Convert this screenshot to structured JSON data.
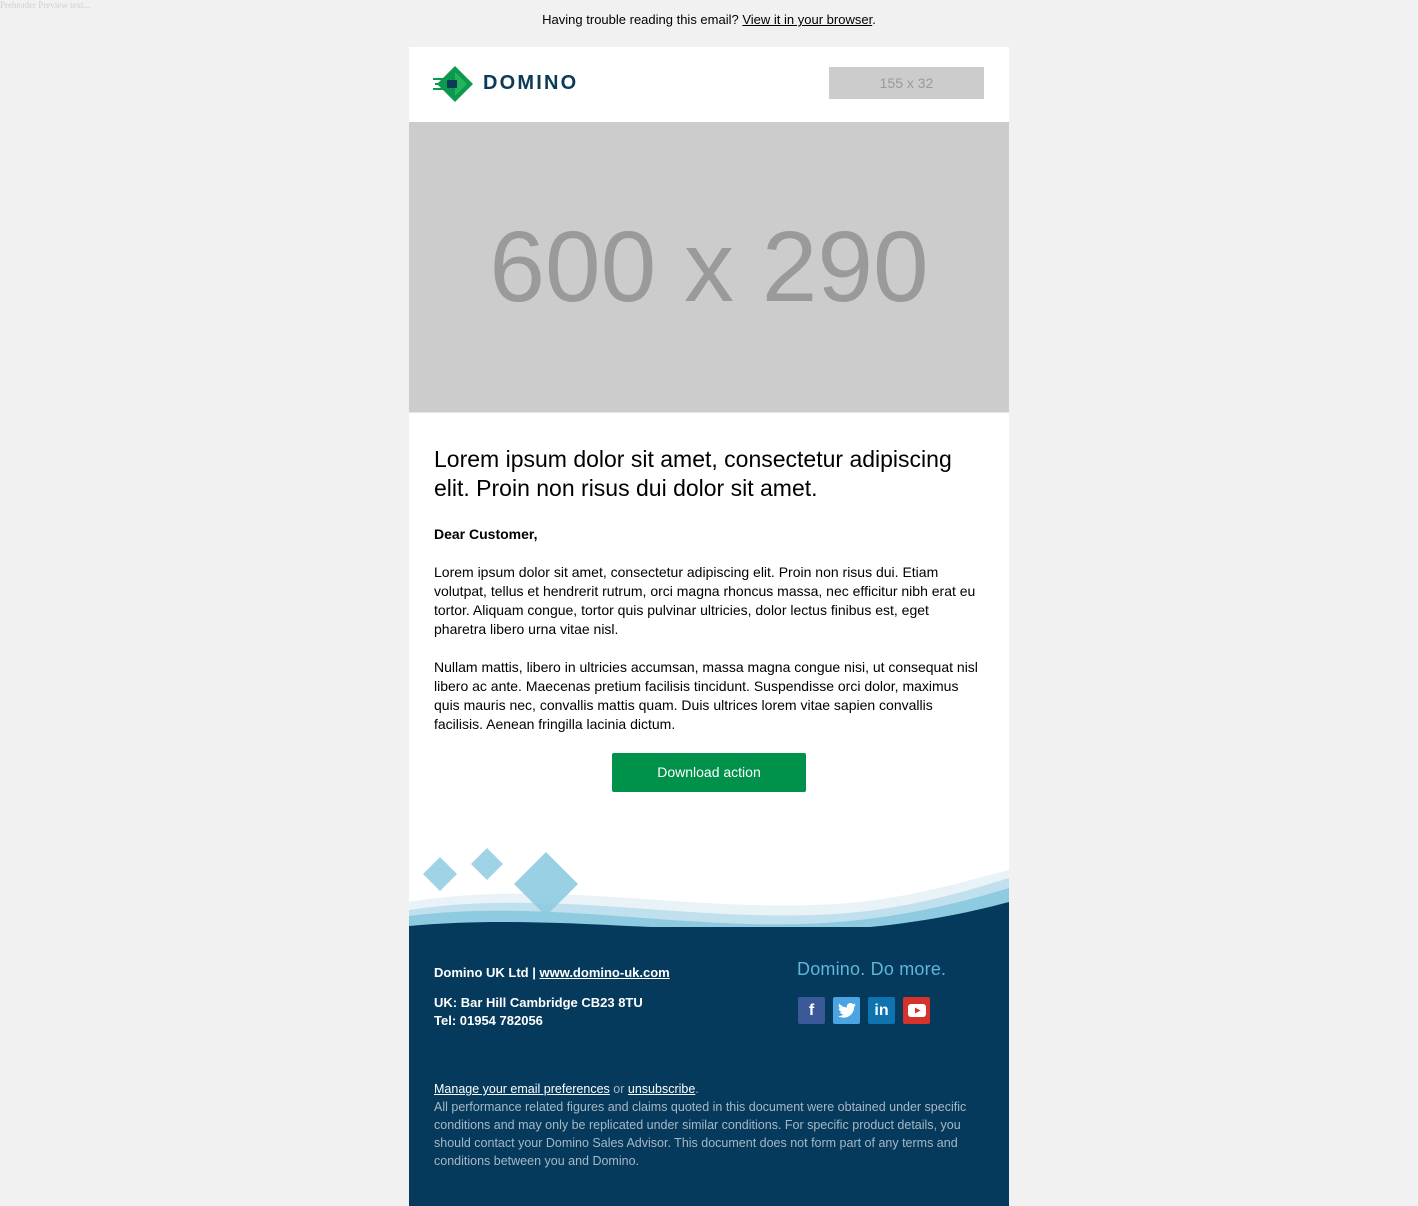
{
  "preheader": "Preheader Preview text...",
  "topbar": {
    "text": "Having trouble reading this email?",
    "link": "View it in your browser",
    "end": "."
  },
  "header": {
    "logo_text": "DOMINO",
    "placeholder": "155 x 32"
  },
  "hero": {
    "placeholder": "600 x 290"
  },
  "content": {
    "headline": "Lorem ipsum dolor sit amet, consectetur adipiscing elit. Proin non risus dui dolor sit amet.",
    "greeting": "Dear Customer,",
    "para1": "Lorem ipsum dolor sit amet, consectetur adipiscing elit. Proin non risus dui. Etiam volutpat, tellus et hendrerit rutrum, orci magna rhoncus massa, nec efficitur nibh erat eu tortor. Aliquam congue, tortor quis pulvinar ultricies, dolor lectus finibus est, eget pharetra libero urna vitae nisl.",
    "para2": "Nullam mattis, libero in ultricies accumsan, massa magna congue nisi, ut consequat nisl libero ac ante. Maecenas pretium facilisis tincidunt. Suspendisse orci dolor, maximus quis mauris nec, convallis mattis quam. Duis ultrices lorem vitae sapien convallis facilisis. Aenean fringilla lacinia dictum.",
    "cta": "Download action"
  },
  "footer": {
    "company": "Domino UK Ltd |",
    "website": "www.domino-uk.com",
    "address_line": "UK: Bar Hill Cambridge CB23 8TU",
    "tel": "Tel: 01954 782056",
    "tagline": "Domino. Do more.",
    "social": [
      {
        "name": "facebook-icon",
        "glyph": "f",
        "color": "#3b5998"
      },
      {
        "name": "twitter-icon",
        "glyph": "t",
        "color": "#4ba5e3"
      },
      {
        "name": "linkedin-icon",
        "glyph": "in",
        "color": "#0e73ae"
      },
      {
        "name": "youtube-icon",
        "glyph": "▶",
        "color": "#d6312a"
      }
    ],
    "manage_link": "Manage your email preferences",
    "or": "or",
    "unsubscribe": "unsubscribe",
    "period": ".",
    "disclaimer": "All performance related figures and claims quoted in this document were obtained under specific conditions and may only be replicated under similar conditions. For specific product details, you should contact your Domino Sales Advisor. This document does not form part of any terms and conditions between you and Domino."
  },
  "colors": {
    "brand_green": "#00914a",
    "footer_navy": "#053a5c",
    "tagline_blue": "#5fb6d6"
  }
}
